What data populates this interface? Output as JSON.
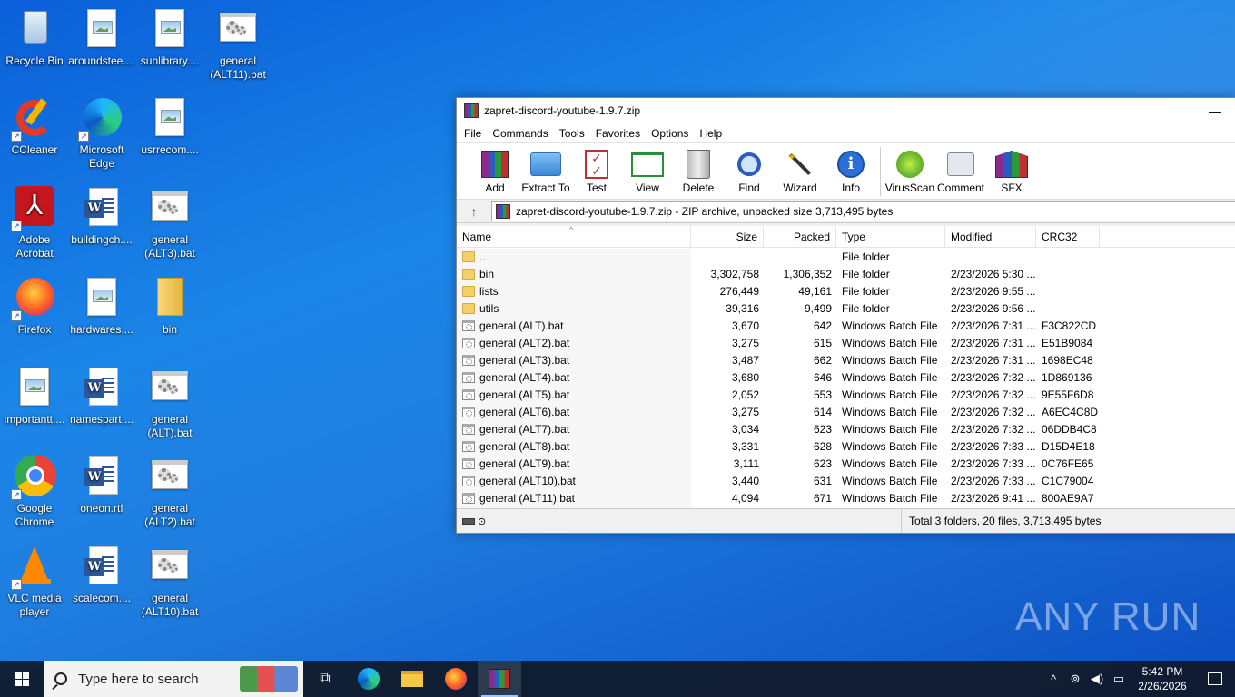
{
  "desktop": {
    "icons": [
      {
        "label": "Recycle Bin",
        "icon": "recycle-bin-icon"
      },
      {
        "label": "aroundstee....",
        "icon": "image-file-icon"
      },
      {
        "label": "sunlibrary....",
        "icon": "image-file-icon"
      },
      {
        "label": "general (ALT11).bat",
        "icon": "batch-file-icon"
      },
      {
        "label": "CCleaner",
        "icon": "ccleaner-icon"
      },
      {
        "label": "Microsoft Edge",
        "icon": "edge-icon"
      },
      {
        "label": "usrrecom....",
        "icon": "image-file-icon"
      },
      {
        "label": "Adobe Acrobat",
        "icon": "acrobat-icon"
      },
      {
        "label": "buildingch....",
        "icon": "word-document-icon"
      },
      {
        "label": "general (ALT3).bat",
        "icon": "batch-file-icon"
      },
      {
        "label": "Firefox",
        "icon": "firefox-icon"
      },
      {
        "label": "hardwares....",
        "icon": "image-file-icon"
      },
      {
        "label": "bin",
        "icon": "folder-icon"
      },
      {
        "label": "importantt....",
        "icon": "image-file-icon"
      },
      {
        "label": "namespart....",
        "icon": "word-document-icon"
      },
      {
        "label": "general (ALT).bat",
        "icon": "batch-file-icon"
      },
      {
        "label": "Google Chrome",
        "icon": "chrome-icon"
      },
      {
        "label": "oneon.rtf",
        "icon": "word-document-icon"
      },
      {
        "label": "general (ALT2).bat",
        "icon": "batch-file-icon"
      },
      {
        "label": "VLC media player",
        "icon": "vlc-icon"
      },
      {
        "label": "scalecom....",
        "icon": "word-document-icon"
      },
      {
        "label": "general (ALT10).bat",
        "icon": "batch-file-icon"
      }
    ]
  },
  "window": {
    "title": "zapret-discord-youtube-1.9.7.zip",
    "minimize": "—",
    "menu": [
      "File",
      "Commands",
      "Tools",
      "Favorites",
      "Options",
      "Help"
    ],
    "toolbar": [
      {
        "label": "Add",
        "icon": "add-archive-icon"
      },
      {
        "label": "Extract To",
        "icon": "extract-folder-icon"
      },
      {
        "label": "Test",
        "icon": "test-checklist-icon"
      },
      {
        "label": "View",
        "icon": "view-book-icon"
      },
      {
        "label": "Delete",
        "icon": "trash-bin-icon"
      },
      {
        "label": "Find",
        "icon": "magnifier-icon"
      },
      {
        "label": "Wizard",
        "icon": "magic-wand-icon"
      },
      {
        "label": "Info",
        "icon": "info-icon"
      },
      {
        "label": "VirusScan",
        "icon": "virus-scan-icon"
      },
      {
        "label": "Comment",
        "icon": "comment-icon"
      },
      {
        "label": "SFX",
        "icon": "sfx-archive-icon"
      }
    ],
    "address": "zapret-discord-youtube-1.9.7.zip - ZIP archive, unpacked size 3,713,495 bytes",
    "columns": {
      "name": "Name",
      "size": "Size",
      "packed": "Packed",
      "type": "Type",
      "modified": "Modified",
      "crc": "CRC32"
    },
    "rows": [
      {
        "name": "..",
        "kind": "folder",
        "size": "",
        "packed": "",
        "type": "File folder",
        "modified": "",
        "crc": ""
      },
      {
        "name": "bin",
        "kind": "folder",
        "size": "3,302,758",
        "packed": "1,306,352",
        "type": "File folder",
        "modified": "2/23/2026 5:30 ...",
        "crc": ""
      },
      {
        "name": "lists",
        "kind": "folder",
        "size": "276,449",
        "packed": "49,161",
        "type": "File folder",
        "modified": "2/23/2026 9:55 ...",
        "crc": ""
      },
      {
        "name": "utils",
        "kind": "folder",
        "size": "39,316",
        "packed": "9,499",
        "type": "File folder",
        "modified": "2/23/2026 9:56 ...",
        "crc": ""
      },
      {
        "name": "general (ALT).bat",
        "kind": "bat",
        "size": "3,670",
        "packed": "642",
        "type": "Windows Batch File",
        "modified": "2/23/2026 7:31 ...",
        "crc": "F3C822CD"
      },
      {
        "name": "general (ALT2).bat",
        "kind": "bat",
        "size": "3,275",
        "packed": "615",
        "type": "Windows Batch File",
        "modified": "2/23/2026 7:31 ...",
        "crc": "E51B9084"
      },
      {
        "name": "general (ALT3).bat",
        "kind": "bat",
        "size": "3,487",
        "packed": "662",
        "type": "Windows Batch File",
        "modified": "2/23/2026 7:31 ...",
        "crc": "1698EC48"
      },
      {
        "name": "general (ALT4).bat",
        "kind": "bat",
        "size": "3,680",
        "packed": "646",
        "type": "Windows Batch File",
        "modified": "2/23/2026 7:32 ...",
        "crc": "1D869136"
      },
      {
        "name": "general (ALT5).bat",
        "kind": "bat",
        "size": "2,052",
        "packed": "553",
        "type": "Windows Batch File",
        "modified": "2/23/2026 7:32 ...",
        "crc": "9E55F6D8"
      },
      {
        "name": "general (ALT6).bat",
        "kind": "bat",
        "size": "3,275",
        "packed": "614",
        "type": "Windows Batch File",
        "modified": "2/23/2026 7:32 ...",
        "crc": "A6EC4C8D"
      },
      {
        "name": "general (ALT7).bat",
        "kind": "bat",
        "size": "3,034",
        "packed": "623",
        "type": "Windows Batch File",
        "modified": "2/23/2026 7:32 ...",
        "crc": "06DDB4C8"
      },
      {
        "name": "general (ALT8).bat",
        "kind": "bat",
        "size": "3,331",
        "packed": "628",
        "type": "Windows Batch File",
        "modified": "2/23/2026 7:33 ...",
        "crc": "D15D4E18"
      },
      {
        "name": "general (ALT9).bat",
        "kind": "bat",
        "size": "3,111",
        "packed": "623",
        "type": "Windows Batch File",
        "modified": "2/23/2026 7:33 ...",
        "crc": "0C76FE65"
      },
      {
        "name": "general (ALT10).bat",
        "kind": "bat",
        "size": "3,440",
        "packed": "631",
        "type": "Windows Batch File",
        "modified": "2/23/2026 7:33 ...",
        "crc": "C1C79004"
      },
      {
        "name": "general (ALT11).bat",
        "kind": "bat",
        "size": "4,094",
        "packed": "671",
        "type": "Windows Batch File",
        "modified": "2/23/2026 9:41 ...",
        "crc": "800AE9A7"
      }
    ],
    "status": "Total 3 folders, 20 files, 3,713,495 bytes"
  },
  "taskbar": {
    "search_placeholder": "Type here to search",
    "apps": [
      "task-view-icon",
      "edge-icon",
      "file-explorer-icon",
      "firefox-icon",
      "winrar-icon"
    ],
    "time": "5:42 PM",
    "date": "2/26/2026"
  },
  "watermark": "ANY RUN"
}
